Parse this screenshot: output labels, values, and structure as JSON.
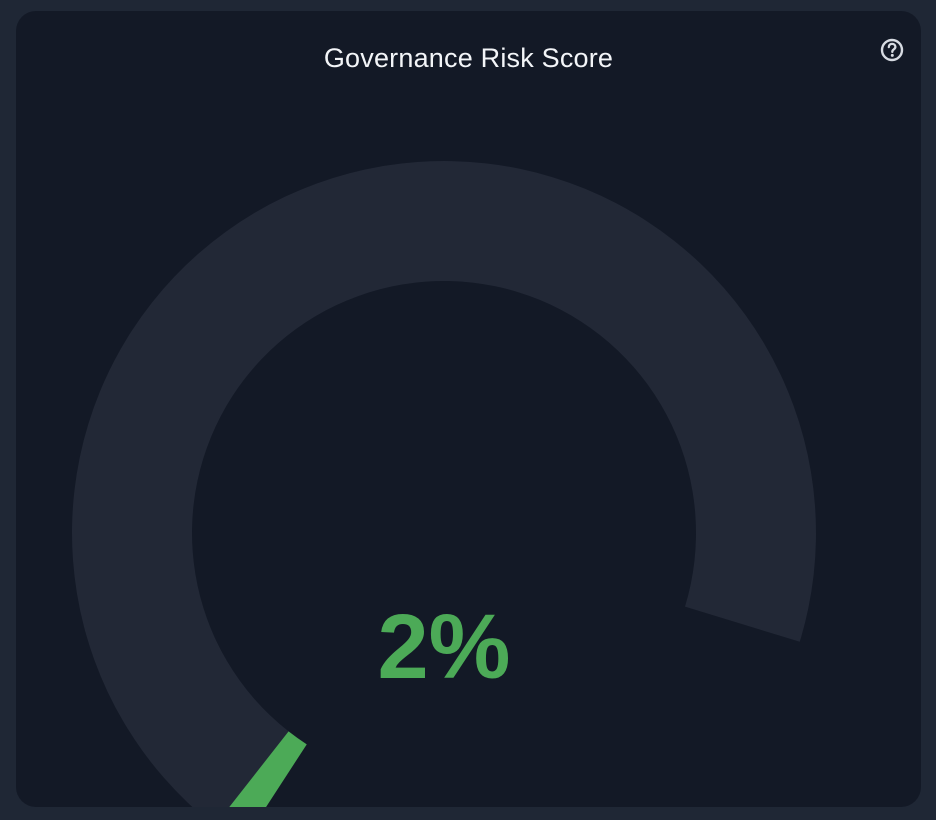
{
  "widget": {
    "title": "Governance Risk Score",
    "help_icon": "help-circle-icon"
  },
  "gauge": {
    "value_label": "2%",
    "value": 2,
    "min": 0,
    "max": 100,
    "track_color": "#222836",
    "fill_color": "#4caa57",
    "value_color": "#4caa57"
  }
}
